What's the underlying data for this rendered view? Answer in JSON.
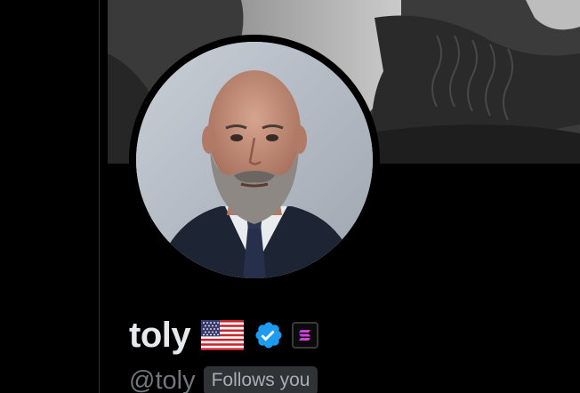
{
  "profile": {
    "display_name": "toly",
    "handle": "@toly",
    "follows_you_label": "Follows you",
    "badges": [
      "us-flag-icon",
      "verified-check-icon",
      "solana-affiliate-icon"
    ]
  },
  "colors": {
    "background": "#000000",
    "name_text": "#e7e9ea",
    "handle_text": "#71767b",
    "verified_blue": "#1d9bf0",
    "divider": "#2f3336",
    "follows_badge_bg": "#2f3336"
  },
  "icons": {
    "flag": "us-flag-icon",
    "verified": "verified-check-icon",
    "affiliate": "solana-logo-icon"
  }
}
